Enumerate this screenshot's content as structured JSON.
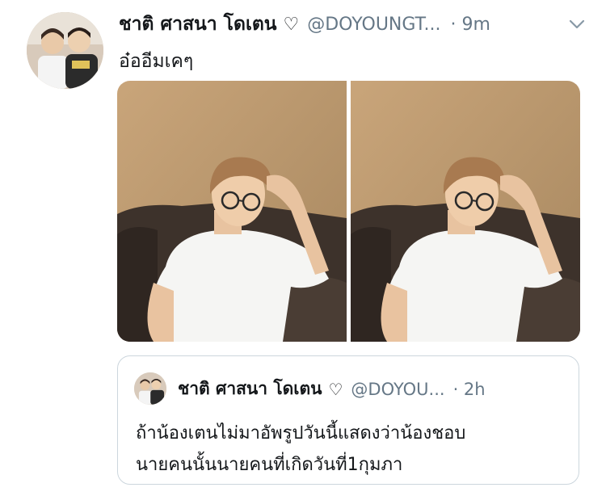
{
  "tweet": {
    "display_name": "ชาติ ศาสนา โดเตน",
    "verified_heart": "♡",
    "handle": "@DOYOUNGT...",
    "time": "· 9m",
    "text": "อ๋ออีมเคๆ",
    "avatar_icon": "user-avatar-photo",
    "caret_icon": "chevron-down-icon",
    "media": [
      {
        "icon": "photo-man-glasses-white-tshirt"
      },
      {
        "icon": "photo-man-glasses-white-tshirt"
      }
    ]
  },
  "quote": {
    "display_name": "ชาติ ศาสนา โดเตน",
    "verified_heart": "♡",
    "handle": "@DOYOU...",
    "time": "· 2h",
    "text_line1": "ถ้าน้องเตนไม่มาอัพรูปวันนี้แสดงว่าน้องชอบ",
    "text_line2": "นายคนนั้นนายคนที่เกิดวันที่1กุมภา"
  },
  "colors": {
    "text": "#14171a",
    "secondary": "#657786",
    "border": "#ccd6dd",
    "background": "#ffffff"
  }
}
